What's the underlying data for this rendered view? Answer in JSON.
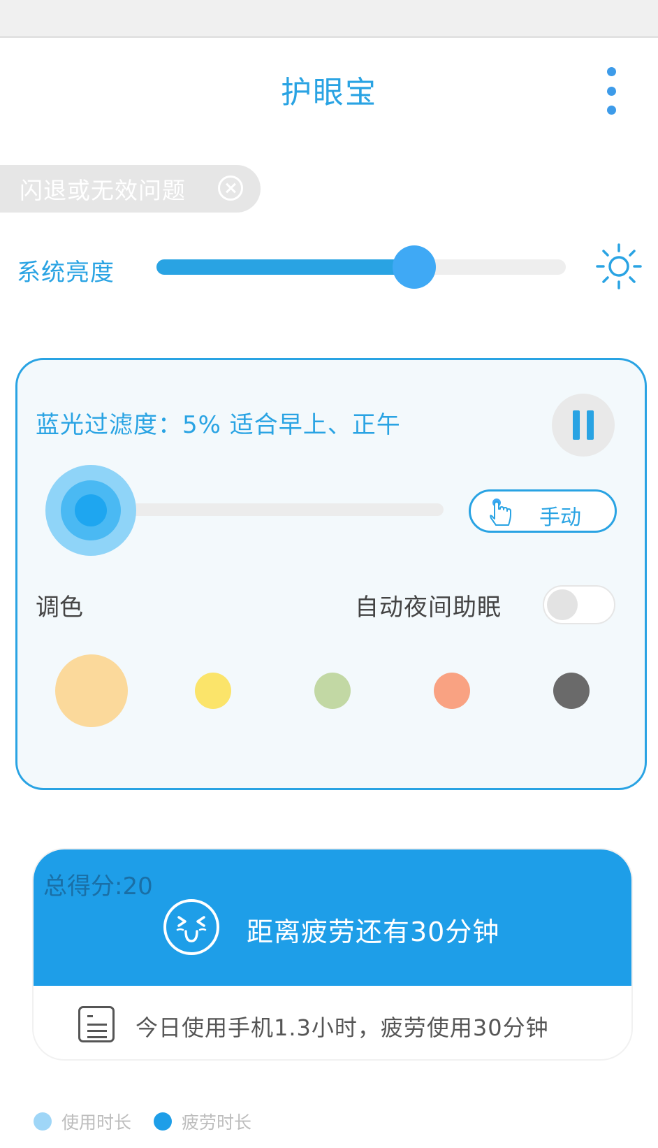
{
  "app": {
    "title": "护眼宝"
  },
  "notice": {
    "text": "闪退或无效问题"
  },
  "brightness": {
    "label": "系统亮度",
    "level": 0.63
  },
  "filter": {
    "text": "蓝光过滤度：5% 适合早上、正午",
    "level": 0.05,
    "mode_label": "手动"
  },
  "tone": {
    "label": "调色"
  },
  "night": {
    "label": "自动夜间助眠",
    "enabled": false
  },
  "swatches": [
    {
      "name": "swatch-apricot",
      "color": "#fbd99b",
      "selected": true
    },
    {
      "name": "swatch-yellow",
      "color": "#fbe46a",
      "selected": false
    },
    {
      "name": "swatch-green",
      "color": "#c2d8a4",
      "selected": false
    },
    {
      "name": "swatch-salmon",
      "color": "#f9a282",
      "selected": false
    },
    {
      "name": "swatch-gray",
      "color": "#6a6a6a",
      "selected": false
    }
  ],
  "score": {
    "label": "总得分:20"
  },
  "fatigue": {
    "text": "距离疲劳还有30分钟"
  },
  "usage": {
    "text": "今日使用手机1.3小时，疲劳使用30分钟"
  },
  "legend": [
    {
      "label": "使用时长",
      "color": "#9fd6f7"
    },
    {
      "label": "疲劳时长",
      "color": "#1e9ee8"
    }
  ],
  "colors": {
    "accent": "#29a3e3",
    "banner": "#1e9ee8"
  }
}
